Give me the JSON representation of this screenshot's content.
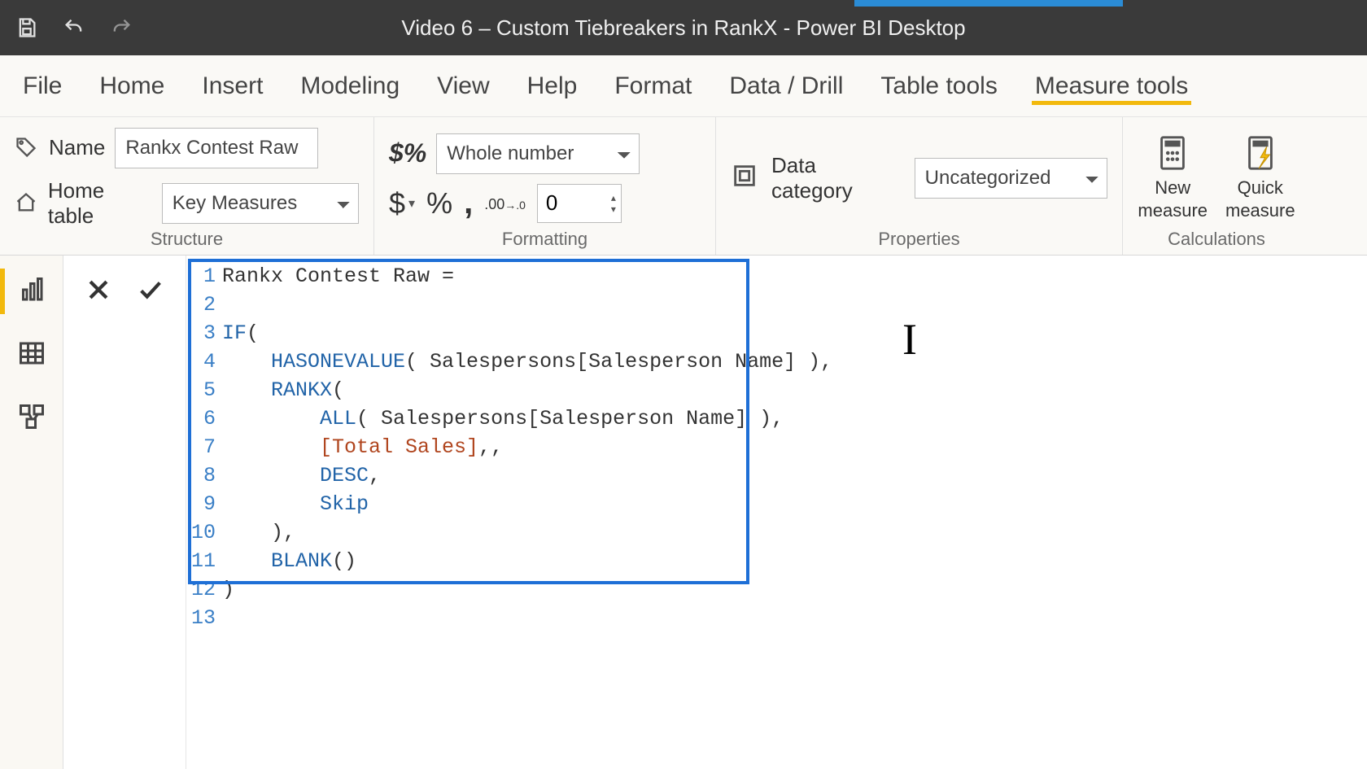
{
  "titlebar": {
    "title": "Video 6 – Custom Tiebreakers in RankX - Power BI Desktop"
  },
  "menubar": {
    "items": [
      "File",
      "Home",
      "Insert",
      "Modeling",
      "View",
      "Help",
      "Format",
      "Data / Drill",
      "Table tools",
      "Measure tools"
    ],
    "active_index": 9
  },
  "ribbon": {
    "structure": {
      "group_label": "Structure",
      "name_label": "Name",
      "name_value": "Rankx Contest Raw",
      "home_table_label": "Home table",
      "home_table_value": "Key Measures"
    },
    "formatting": {
      "group_label": "Formatting",
      "format_value": "Whole number",
      "currency_symbol": "$",
      "percent_symbol": "%",
      "thousands_symbol": ",",
      "decimal_icon_text": ".00",
      "decimals_value": "0"
    },
    "properties": {
      "group_label": "Properties",
      "data_category_label": "Data category",
      "data_category_value": "Uncategorized"
    },
    "calculations": {
      "group_label": "Calculations",
      "new_measure": "New\nmeasure",
      "quick_measure": "Quick\nmeasure"
    }
  },
  "formula": {
    "lines": [
      {
        "n": 1,
        "segments": [
          {
            "t": "txt",
            "v": "Rankx Contest Raw ="
          }
        ]
      },
      {
        "n": 2,
        "segments": []
      },
      {
        "n": 3,
        "segments": [
          {
            "t": "kw",
            "v": "IF"
          },
          {
            "t": "txt",
            "v": "("
          }
        ]
      },
      {
        "n": 4,
        "segments": [
          {
            "t": "txt",
            "v": "    "
          },
          {
            "t": "kw",
            "v": "HASONEVALUE"
          },
          {
            "t": "txt",
            "v": "( Salespersons[Salesperson Name] ),"
          }
        ]
      },
      {
        "n": 5,
        "segments": [
          {
            "t": "txt",
            "v": "    "
          },
          {
            "t": "kw",
            "v": "RANKX"
          },
          {
            "t": "txt",
            "v": "("
          }
        ]
      },
      {
        "n": 6,
        "segments": [
          {
            "t": "txt",
            "v": "        "
          },
          {
            "t": "kw",
            "v": "ALL"
          },
          {
            "t": "txt",
            "v": "( Salespersons[Salesperson Name] ),"
          }
        ]
      },
      {
        "n": 7,
        "segments": [
          {
            "t": "txt",
            "v": "        "
          },
          {
            "t": "meas",
            "v": "[Total Sales]"
          },
          {
            "t": "txt",
            "v": ",,"
          }
        ]
      },
      {
        "n": 8,
        "segments": [
          {
            "t": "txt",
            "v": "        "
          },
          {
            "t": "kw",
            "v": "DESC"
          },
          {
            "t": "txt",
            "v": ","
          }
        ]
      },
      {
        "n": 9,
        "segments": [
          {
            "t": "txt",
            "v": "        "
          },
          {
            "t": "kw",
            "v": "Skip"
          }
        ]
      },
      {
        "n": 10,
        "segments": [
          {
            "t": "txt",
            "v": "    ),"
          }
        ]
      },
      {
        "n": 11,
        "segments": [
          {
            "t": "txt",
            "v": "    "
          },
          {
            "t": "kw",
            "v": "BLANK"
          },
          {
            "t": "txt",
            "v": "()"
          }
        ]
      },
      {
        "n": 12,
        "segments": [
          {
            "t": "txt",
            "v": ")"
          }
        ]
      },
      {
        "n": 13,
        "segments": []
      }
    ]
  }
}
